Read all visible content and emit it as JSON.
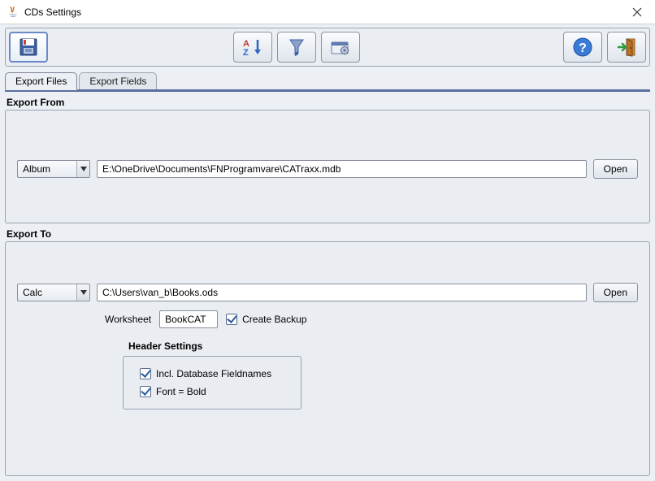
{
  "window": {
    "title": "CDs Settings"
  },
  "tabs": {
    "export_files": "Export Files",
    "export_fields": "Export Fields"
  },
  "sections": {
    "export_from": "Export From",
    "export_to": "Export To"
  },
  "export_from": {
    "type_selected": "Album",
    "path": "E:\\OneDrive\\Documents\\FNProgramvare\\CATraxx.mdb",
    "open_label": "Open"
  },
  "export_to": {
    "type_selected": "Calc",
    "path": "C:\\Users\\van_b\\Books.ods",
    "open_label": "Open",
    "worksheet_label": "Worksheet",
    "worksheet_value": "BookCAT",
    "create_backup_label": "Create Backup",
    "create_backup_checked": true,
    "header_settings": {
      "legend": "Header Settings",
      "incl_fieldnames_label": "Incl. Database Fieldnames",
      "incl_fieldnames_checked": true,
      "font_bold_label": "Font = Bold",
      "font_bold_checked": true
    }
  }
}
